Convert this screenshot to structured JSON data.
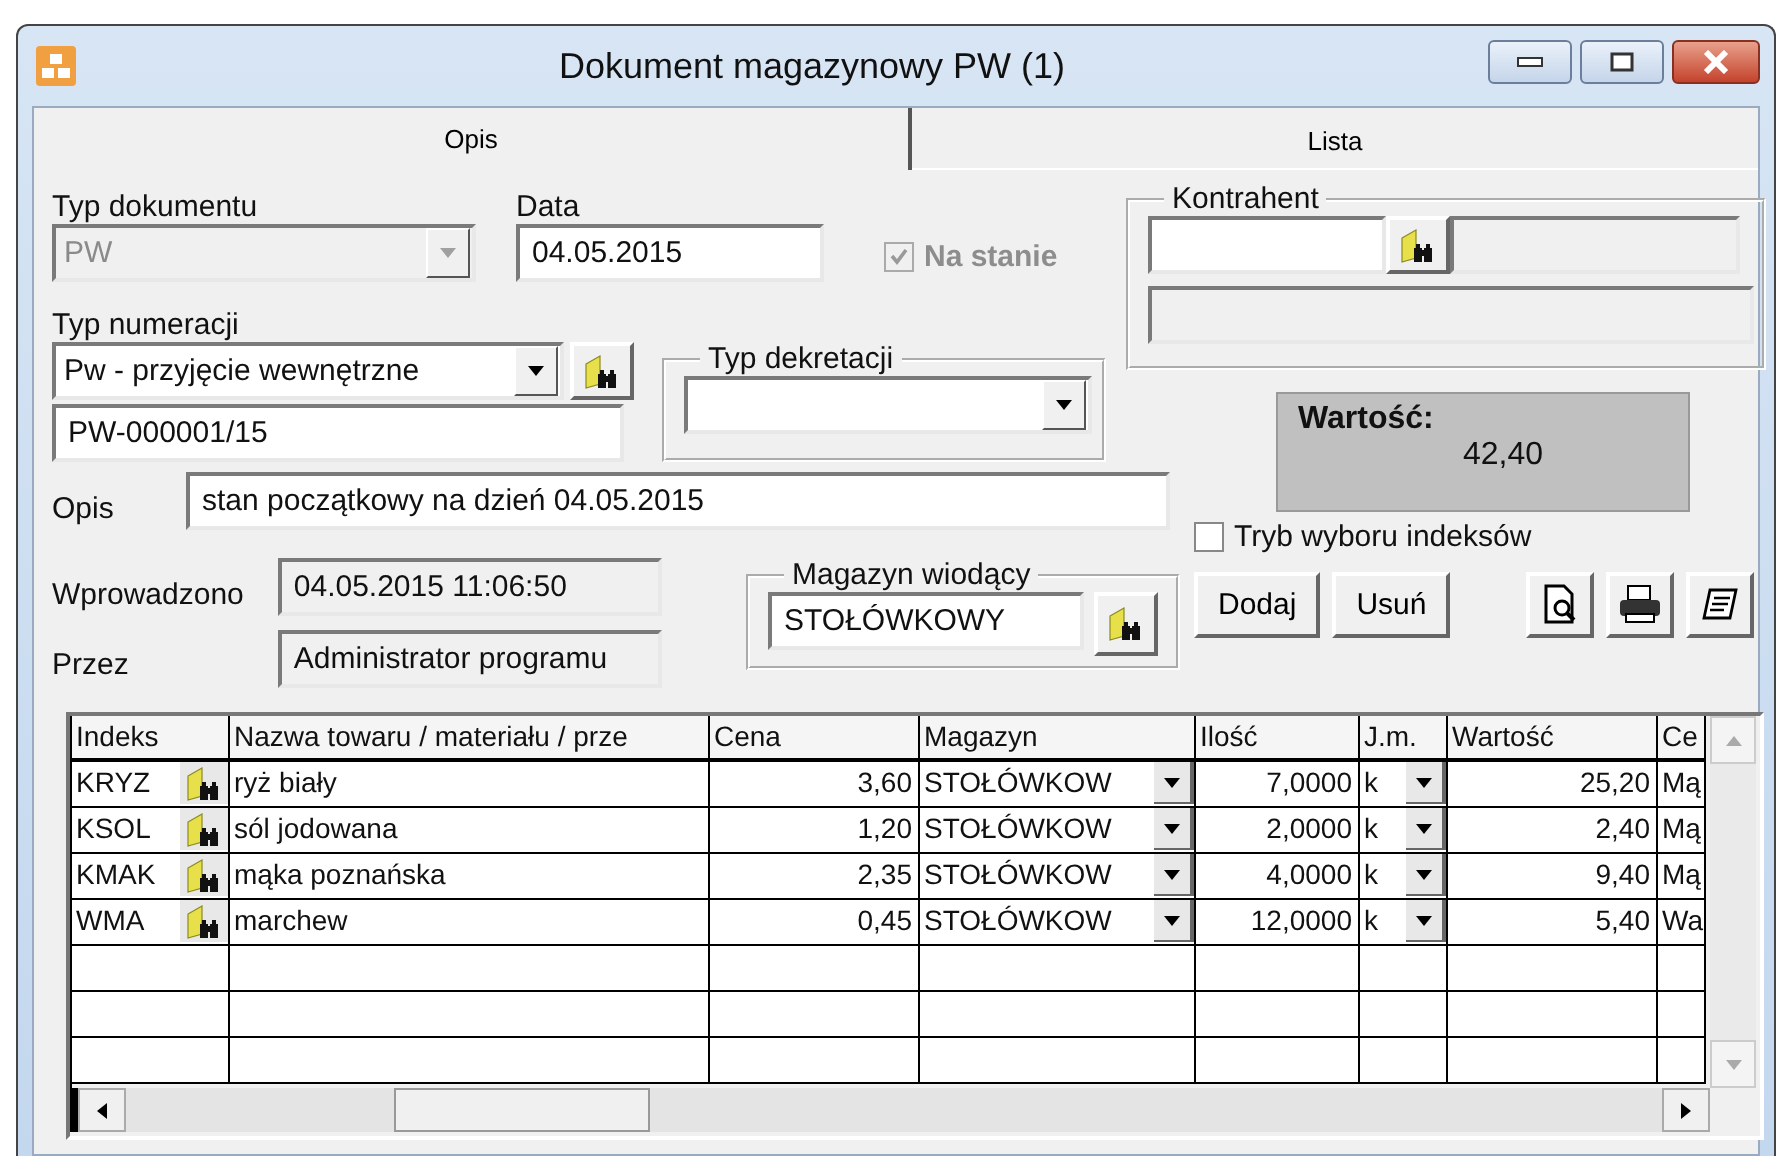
{
  "window": {
    "title": "Dokument magazynowy PW (1)"
  },
  "tabs": [
    {
      "label": "Opis",
      "selected": true
    },
    {
      "label": "Lista",
      "selected": false
    }
  ],
  "document_type": {
    "label": "Typ dokumentu",
    "value": "PW",
    "disabled": true
  },
  "date": {
    "label": "Data",
    "value": "04.05.2015"
  },
  "in_stock": {
    "label": "Na stanie",
    "checked": true,
    "disabled": true
  },
  "contractor": {
    "label": "Kontrahent"
  },
  "numbering_type": {
    "label": "Typ numeracji",
    "value": "Pw  - przyjęcie wewnętrzne"
  },
  "number": {
    "value": "PW-000001/15"
  },
  "posting_type": {
    "label": "Typ dekretacji"
  },
  "total": {
    "label": "Wartość:",
    "value": "42,40"
  },
  "description": {
    "label": "Opis",
    "value": "stan początkowy na dzień 04.05.2015"
  },
  "index_mode": {
    "label": "Tryb wyboru indeksów",
    "checked": false
  },
  "entered": {
    "label": "Wprowadzono",
    "value": "04.05.2015 11:06:50"
  },
  "by": {
    "label": "Przez",
    "value": "Administrator programu"
  },
  "main_warehouse": {
    "label": "Magazyn wiodący",
    "value": "STOŁÓWKOWY"
  },
  "buttons": [
    {
      "label": "Dodaj"
    },
    {
      "label": "Usuń"
    }
  ],
  "table": {
    "columns": [
      {
        "label": "Indeks",
        "kind": "lookup"
      },
      {
        "label": "Nazwa towaru / materiału / prze",
        "kind": "text"
      },
      {
        "label": "Cena",
        "kind": "number"
      },
      {
        "label": "Magazyn",
        "kind": "combo"
      },
      {
        "label": "Ilość",
        "kind": "number"
      },
      {
        "label": "J.m.",
        "kind": "combo"
      },
      {
        "label": "Wartość",
        "kind": "number"
      },
      {
        "label": "Ce",
        "kind": "text"
      }
    ],
    "rows": [
      [
        "KRYZ",
        "ryż biały",
        "3,60",
        "STOŁÓWKOW",
        "7,0000",
        "k",
        "25,20",
        "Mą"
      ],
      [
        "KSOL",
        "sól jodowana",
        "1,20",
        "STOŁÓWKOW",
        "2,0000",
        "k",
        "2,40",
        "Mą"
      ],
      [
        "KMAK",
        "mąka poznańska",
        "2,35",
        "STOŁÓWKOW",
        "4,0000",
        "k",
        "9,40",
        "Mą"
      ],
      [
        "WMA",
        "marchew",
        "0,45",
        "STOŁÓWKOW",
        "12,0000",
        "k",
        "5,40",
        "Wa"
      ]
    ]
  }
}
